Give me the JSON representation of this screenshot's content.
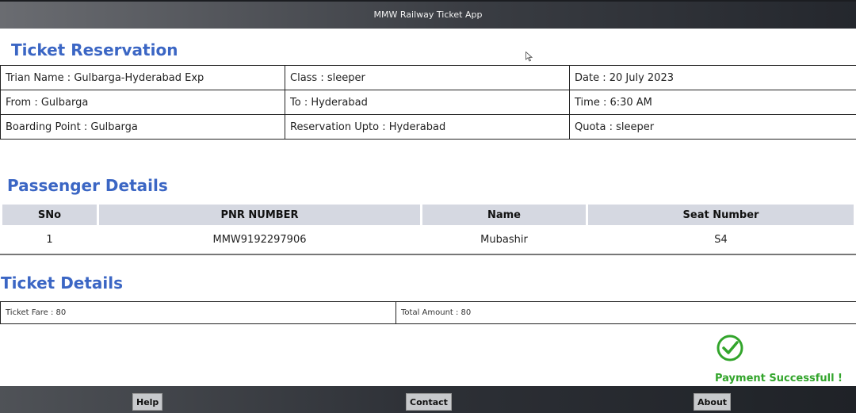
{
  "app": {
    "title": "MMW Railway Ticket App"
  },
  "reservation": {
    "heading": "Ticket Reservation",
    "rows": [
      [
        "Trian Name : Gulbarga-Hyderabad Exp",
        "Class : sleeper",
        "Date : 20 July 2023"
      ],
      [
        "From : Gulbarga",
        "To : Hyderabad",
        "Time : 6:30 AM"
      ],
      [
        "Boarding Point : Gulbarga",
        "Reservation Upto : Hyderabad",
        "Quota : sleeper"
      ]
    ]
  },
  "passengers": {
    "heading": "Passenger Details",
    "columns": [
      "SNo",
      "PNR NUMBER",
      "Name",
      "Seat Number"
    ],
    "rows": [
      [
        "1",
        "MMW9192297906",
        "Mubashir",
        "S4"
      ]
    ]
  },
  "ticket": {
    "heading": "Ticket Details",
    "fare": "Ticket Fare : 80",
    "total": "Total Amount : 80"
  },
  "payment": {
    "message": "Payment Successfull !",
    "icon": "check-circle-icon",
    "color": "#33a52c"
  },
  "footer": {
    "help": "Help",
    "contact": "Contact",
    "about": "About"
  },
  "colors": {
    "heading": "#3b66c4",
    "header_bg": "#d5d8e1"
  }
}
